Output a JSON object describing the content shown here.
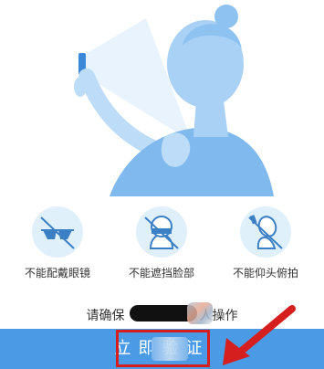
{
  "illustration": {
    "description_icon": "face-scan-illustration"
  },
  "tips": [
    {
      "icon": "no-glasses-icon",
      "label": "不能配戴眼镜"
    },
    {
      "icon": "no-cover-face-icon",
      "label": "不能遮挡脸部"
    },
    {
      "icon": "no-tilt-head-icon",
      "label": "不能仰头俯拍"
    }
  ],
  "notice": {
    "text_prefix": "请确保",
    "text_suffix": "人操作"
  },
  "cta": {
    "label": "立即验证",
    "color": "#4a9ae6"
  },
  "annotation": {
    "box_color": "#d51f1f",
    "arrow_icon": "red-arrow-icon"
  }
}
